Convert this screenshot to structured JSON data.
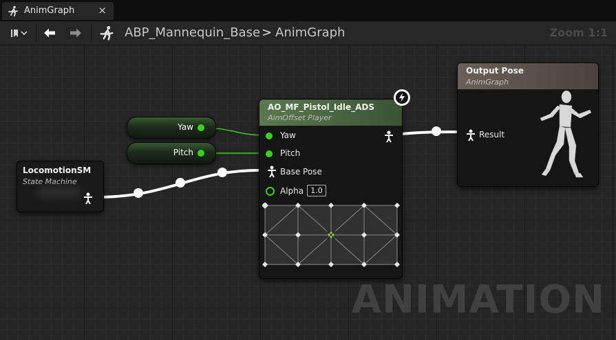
{
  "tab": {
    "title": "AnimGraph",
    "close": "×"
  },
  "toolbar": {
    "breadcrumb_asset": "ABP_Mannequin_Base",
    "breadcrumb_sep": ">",
    "breadcrumb_graph": "AnimGraph",
    "zoom": "Zoom 1:1"
  },
  "nodes": {
    "locomotion": {
      "title": "LocomotionSM",
      "subtitle": "State Machine"
    },
    "yaw_var": {
      "label": "Yaw"
    },
    "pitch_var": {
      "label": "Pitch"
    },
    "aimoffset": {
      "title": "AO_MF_Pistol_Idle_ADS",
      "subtitle": "AimOffset Player",
      "pins": {
        "yaw": "Yaw",
        "pitch": "Pitch",
        "base_pose": "Base Pose",
        "alpha": "Alpha"
      },
      "alpha_value": "1.0"
    },
    "output": {
      "title": "Output Pose",
      "subtitle": "AnimGraph",
      "pin_result": "Result"
    }
  },
  "watermark": "ANIMATION",
  "colors": {
    "float_pin": "#39d11a",
    "aimoffset_header": "#5a7a4e",
    "output_header": "#6a6058"
  }
}
